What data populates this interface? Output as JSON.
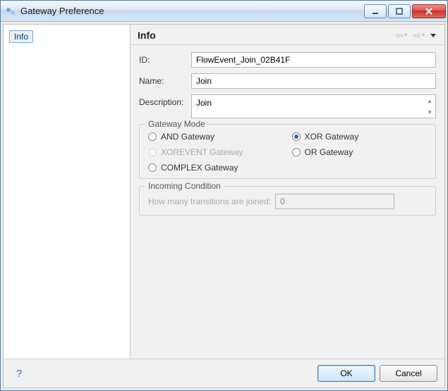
{
  "window": {
    "title": "Gateway Preference"
  },
  "sidebar": {
    "items": [
      {
        "label": "Info"
      }
    ]
  },
  "header": {
    "heading": "Info"
  },
  "form": {
    "id_label": "ID:",
    "id_value": "FlowEvent_Join_02B41F",
    "name_label": "Name:",
    "name_value": "Join",
    "description_label": "Description:",
    "description_value": "Join"
  },
  "gateway_mode": {
    "legend": "Gateway Mode",
    "options": {
      "and": {
        "label": "AND Gateway",
        "checked": false,
        "disabled": false
      },
      "xor": {
        "label": "XOR Gateway",
        "checked": true,
        "disabled": false
      },
      "xorevent": {
        "label": "XOREVENT Gateway",
        "checked": false,
        "disabled": true
      },
      "or": {
        "label": "OR Gateway",
        "checked": false,
        "disabled": false
      },
      "complex": {
        "label": "COMPLEX Gateway",
        "checked": false,
        "disabled": false
      }
    }
  },
  "incoming": {
    "legend": "Incoming Condition",
    "label": "How many transitions are joined:",
    "value": "0"
  },
  "footer": {
    "ok": "OK",
    "cancel": "Cancel"
  }
}
